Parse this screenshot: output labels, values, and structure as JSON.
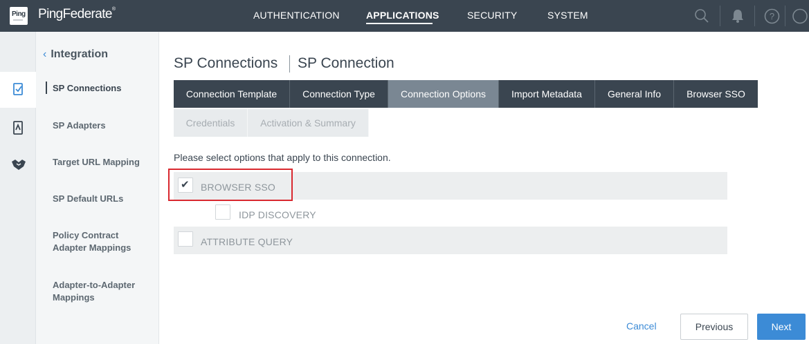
{
  "header": {
    "logo_text": "Ping",
    "brand": "PingFederate",
    "brand_mark": "®",
    "nav": [
      {
        "label": "AUTHENTICATION",
        "active": false
      },
      {
        "label": "APPLICATIONS",
        "active": true
      },
      {
        "label": "SECURITY",
        "active": false
      },
      {
        "label": "SYSTEM",
        "active": false
      }
    ],
    "icons": [
      "search-icon",
      "bell-icon",
      "help-icon",
      "user-icon"
    ],
    "help_glyph": "?"
  },
  "rail": {
    "icons": [
      "sp-connection-icon",
      "sp-adapter-icon",
      "handshake-icon"
    ]
  },
  "sidebar": {
    "back_chevron": "‹",
    "heading": "Integration",
    "items": [
      {
        "label": "SP Connections",
        "active": true
      },
      {
        "label": "SP Adapters",
        "active": false
      },
      {
        "label": "Target URL Mapping",
        "active": false
      },
      {
        "label": "SP Default URLs",
        "active": false
      },
      {
        "label": "Policy Contract Adapter Mappings",
        "active": false
      },
      {
        "label": "Adapter-to-Adapter Mappings",
        "active": false
      }
    ]
  },
  "breadcrumb": {
    "parent": "SP Connections",
    "current": "SP Connection"
  },
  "tabs": [
    {
      "label": "Connection Template",
      "state": "normal"
    },
    {
      "label": "Connection Type",
      "state": "normal"
    },
    {
      "label": "Connection Options",
      "state": "selected"
    },
    {
      "label": "Import Metadata",
      "state": "normal"
    },
    {
      "label": "General Info",
      "state": "normal"
    },
    {
      "label": "Browser SSO",
      "state": "normal"
    },
    {
      "label": "Credentials",
      "state": "disabled"
    },
    {
      "label": "Activation & Summary",
      "state": "disabled"
    }
  ],
  "main": {
    "instructions": "Please select options that apply to this connection.",
    "options": [
      {
        "label": "BROWSER SSO",
        "checked": true
      },
      {
        "label": "IDP DISCOVERY",
        "checked": false
      },
      {
        "label": "ATTRIBUTE QUERY",
        "checked": false
      }
    ],
    "check_glyph": "✔"
  },
  "footer": {
    "cancel": "Cancel",
    "previous": "Previous",
    "next": "Next"
  },
  "colors": {
    "topbar": "#3a4550",
    "accent": "#3c8bd6",
    "selected_tab": "#7a8793",
    "highlight": "#d9282f"
  }
}
